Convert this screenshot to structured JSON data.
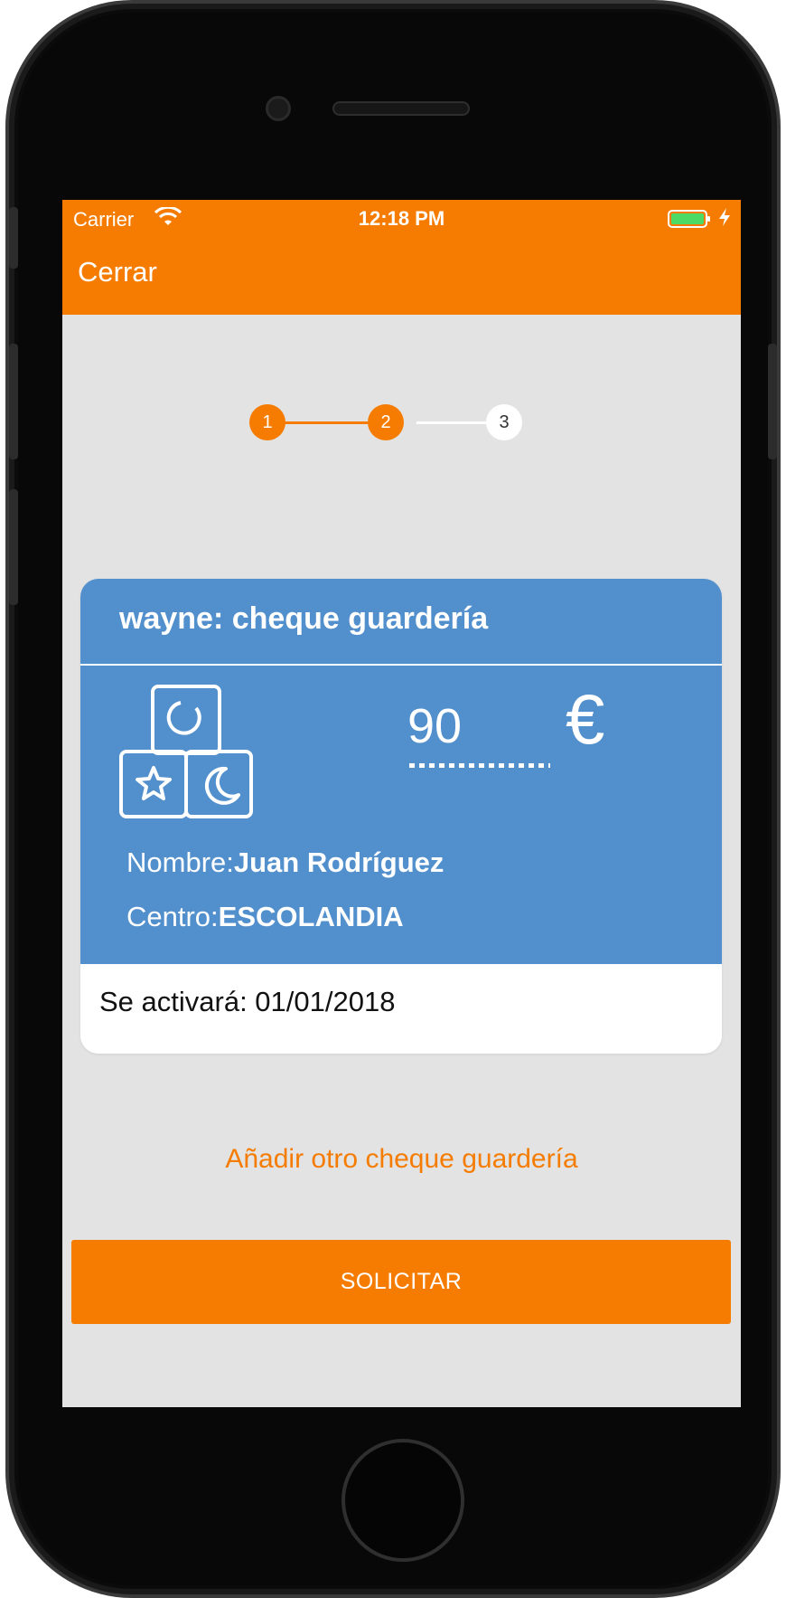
{
  "status_bar": {
    "carrier": "Carrier",
    "time": "12:18 PM",
    "icons": [
      "wifi-icon",
      "battery-icon",
      "charging-icon"
    ],
    "battery_color": "#4cd964"
  },
  "nav": {
    "close_label": "Cerrar"
  },
  "stepper": {
    "steps": [
      {
        "label": "1",
        "state": "done"
      },
      {
        "label": "2",
        "state": "current"
      },
      {
        "label": "3",
        "state": "pending"
      }
    ],
    "completed_steps": 2,
    "total_steps": 3
  },
  "voucher": {
    "title": "wayne: cheque guardería",
    "icon": "toy-blocks-icon",
    "amount": "90",
    "currency": "€",
    "name_label": "Nombre:",
    "name_value": "Juan Rodríguez",
    "center_label": "Centro:",
    "center_value": "ESCOLANDIA",
    "activation": "Se activará: 01/01/2018"
  },
  "actions": {
    "add_link": "Añadir otro cheque guardería",
    "submit_label": "SOLICITAR"
  },
  "colors": {
    "accent": "#f57c00",
    "card_blue": "#528fcd",
    "background": "#e3e3e3"
  }
}
